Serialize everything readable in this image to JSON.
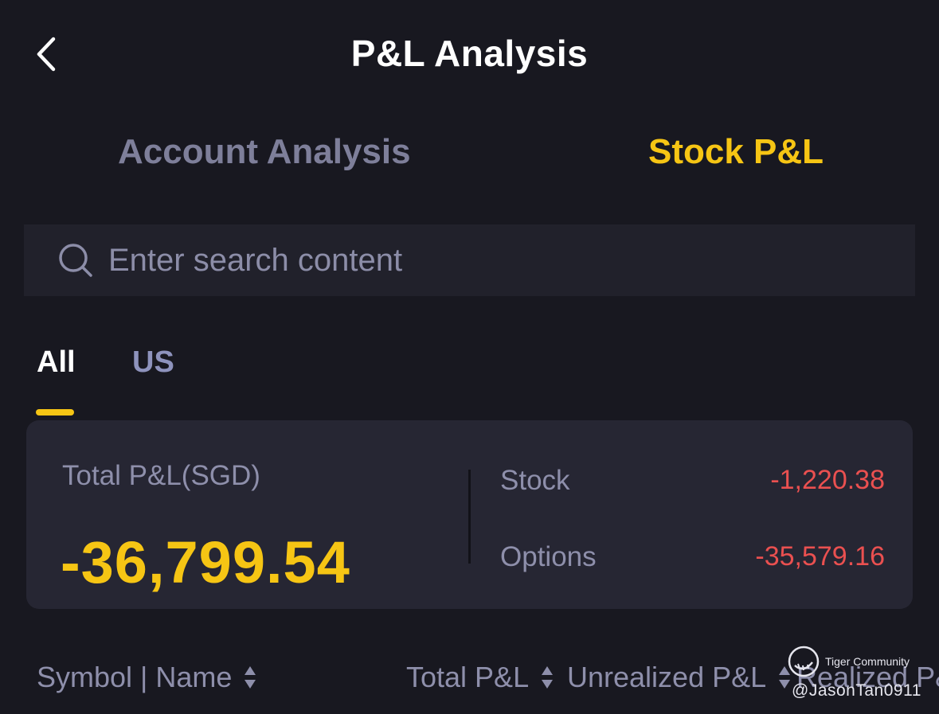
{
  "header": {
    "title": "P&L Analysis",
    "back_icon": "chevron-left-icon"
  },
  "top_tabs": [
    {
      "label": "Account Analysis",
      "active": false
    },
    {
      "label": "Stock P&L",
      "active": true
    }
  ],
  "search": {
    "placeholder": "Enter search content",
    "value": "",
    "icon": "search-icon"
  },
  "market_tabs": [
    {
      "label": "All",
      "active": true
    },
    {
      "label": "US",
      "active": false
    }
  ],
  "summary": {
    "total_label": "Total P&L(SGD)",
    "total_value": "-36,799.54",
    "breakdown": [
      {
        "label": "Stock",
        "value": "-1,220.38"
      },
      {
        "label": "Options",
        "value": "-35,579.16"
      }
    ]
  },
  "columns": {
    "symbol_name": "Symbol | Name",
    "total_pl": "Total P&L",
    "unrealized_pl": "Unrealized P&L",
    "realized_pl": "Realized P&L"
  },
  "watermark": {
    "brand": "Tiger Community",
    "handle": "@JasonTan0911"
  },
  "colors": {
    "background": "#181820",
    "card": "#262633",
    "accent": "#f6c514",
    "loss": "#ea5050",
    "muted": "#8e8fab"
  }
}
